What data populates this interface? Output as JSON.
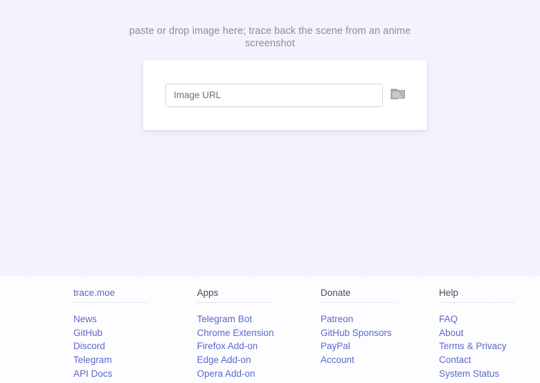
{
  "main": {
    "drop_hint": "paste or drop image here; trace back the scene from an anime screenshot",
    "upload": {
      "url_placeholder": "Image URL",
      "url_value": "",
      "file_picker_icon": "folder-icon"
    }
  },
  "footer": {
    "columns": [
      {
        "heading": "trace.moe",
        "heading_is_link": true,
        "links": [
          "News",
          "GitHub",
          "Discord",
          "Telegram",
          "API Docs"
        ]
      },
      {
        "heading": "Apps",
        "heading_is_link": false,
        "links": [
          "Telegram Bot",
          "Chrome Extension",
          "Firefox Add-on",
          "Edge Add-on",
          "Opera Add-on"
        ]
      },
      {
        "heading": "Donate",
        "heading_is_link": false,
        "links": [
          "Patreon",
          "GitHub Sponsors",
          "PayPal",
          "Account"
        ]
      },
      {
        "heading": "Help",
        "heading_is_link": false,
        "links": [
          "FAQ",
          "About",
          "Terms & Privacy",
          "Contact",
          "System Status"
        ]
      }
    ]
  },
  "colors": {
    "page_background": "#f4f2fd",
    "footer_background": "#fdfdff",
    "link": "#5b68c8",
    "heading_text": "#4b4b52",
    "hint_text": "#8d8d96",
    "card_background": "#ffffff",
    "input_border": "#d3d3d8"
  }
}
